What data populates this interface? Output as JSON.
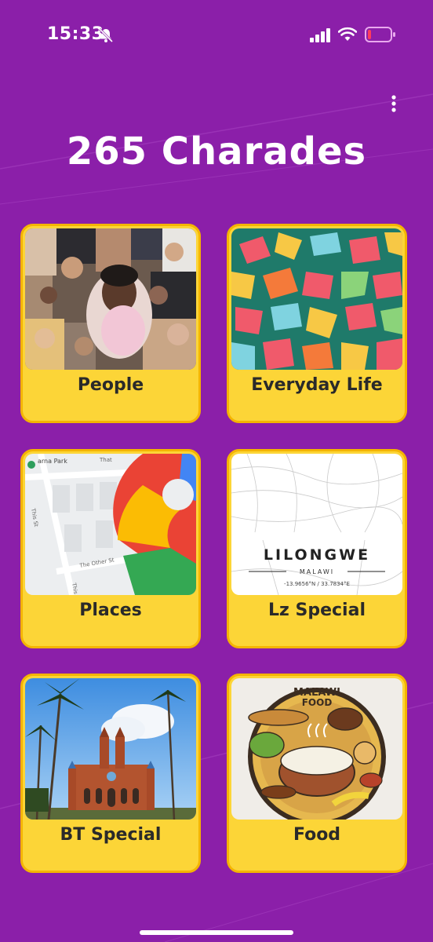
{
  "status_bar": {
    "time": "15:33",
    "icons": [
      "bell-muted-icon",
      "signal-icon",
      "wifi-icon",
      "battery-low-icon"
    ]
  },
  "header": {
    "menu_icon": "more-vertical-icon",
    "title": "265 Charades"
  },
  "categories": [
    {
      "label": "People",
      "thumb": "people-collage"
    },
    {
      "label": "Everyday Life",
      "thumb": "colorful-pattern"
    },
    {
      "label": "Places",
      "thumb": "map-pin"
    },
    {
      "label": "Lz Special",
      "thumb": "lilongwe-map"
    },
    {
      "label": "BT Special",
      "thumb": "blantyre-church"
    },
    {
      "label": "Food",
      "thumb": "malawi-food"
    }
  ],
  "lilongwe_map": {
    "city": "LILONGWE",
    "country": "MALAWI",
    "coords": "-13.9656°N / 33.7834°E"
  },
  "places_map": {
    "park": "arna Park",
    "streets": [
      "That St",
      "This St",
      "The Other St",
      "This St",
      "That"
    ]
  },
  "food_badge": {
    "line1": "MALAWI",
    "line2": "FOOD"
  },
  "colors": {
    "background": "#8b1fa9",
    "card": "#fcd537",
    "card_border": "#f4b400",
    "title_text": "#ffffff"
  }
}
